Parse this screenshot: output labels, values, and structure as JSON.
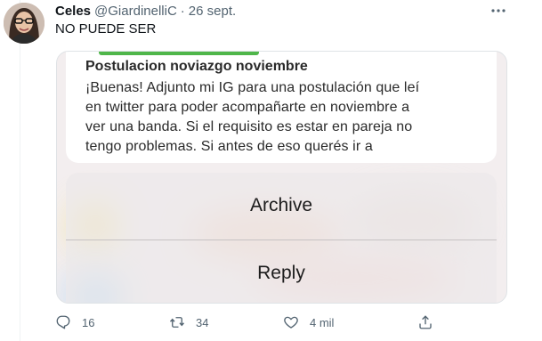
{
  "tweet": {
    "author_name": "Celes",
    "handle": "@GiardinelliC",
    "separator": "·",
    "date": "26 sept.",
    "text": "NO PUEDE SER",
    "more_icon": "more-horizontal-icon"
  },
  "media": {
    "notification": {
      "title": "Postulacion noviazgo noviembre",
      "body_lines": [
        "¡Buenas! Adjunto mi IG para una postulación que leí",
        "en twitter para poder acompañarte en noviembre a",
        "ver una banda. Si el requisito es estar en pareja no",
        "tengo problemas. Si antes de eso querés ir a"
      ]
    },
    "menu": {
      "archive_label": "Archive",
      "reply_label": "Reply"
    }
  },
  "actions": {
    "replies": "16",
    "retweets": "34",
    "likes": "4 mil"
  },
  "colors": {
    "accent_green": "#4fb64a",
    "muted_text": "#536471"
  }
}
